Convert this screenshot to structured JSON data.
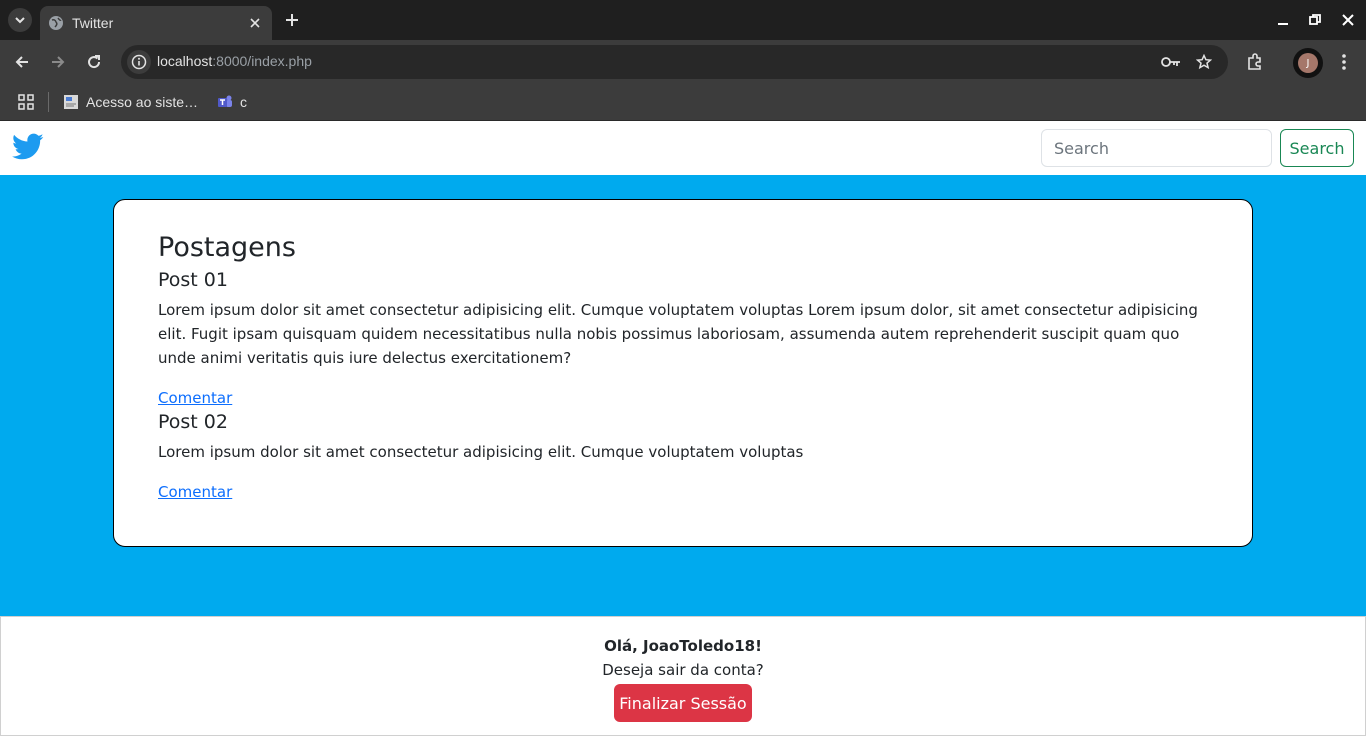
{
  "browser": {
    "tab_title": "Twitter",
    "url_host": "localhost",
    "url_rest": ":8000/index.php",
    "avatar_initial": "J",
    "bookmarks": [
      {
        "label": "Acesso ao siste…",
        "icon": "document-icon"
      },
      {
        "label": "c",
        "icon": "teams-icon"
      }
    ]
  },
  "navbar": {
    "logo": "twitter-bird-icon",
    "search_placeholder": "Search",
    "search_button": "Search"
  },
  "main": {
    "title": "Postagens",
    "posts": [
      {
        "title": "Post 01",
        "body": "Lorem ipsum dolor sit amet consectetur adipisicing elit. Cumque voluptatem voluptas Lorem ipsum dolor, sit amet consectetur adipisicing elit. Fugit ipsam quisquam quidem necessitatibus nulla nobis possimus laboriosam, assumenda autem reprehenderit suscipit quam quo unde animi veritatis quis iure delectus exercitationem?",
        "link": "Comentar"
      },
      {
        "title": "Post 02",
        "body": "Lorem ipsum dolor sit amet consectetur adipisicing elit. Cumque voluptatem voluptas",
        "link": "Comentar"
      }
    ]
  },
  "footer": {
    "greeting": "Olá, JoaoToledo18!",
    "question": "Deseja sair da conta?",
    "logout_button": "Finalizar Sessão"
  },
  "colors": {
    "page_background": "#00aaee",
    "brand": "#1d9bf0",
    "search_button": "#198754",
    "logout_button": "#dc3545",
    "link": "#0d6efd"
  }
}
